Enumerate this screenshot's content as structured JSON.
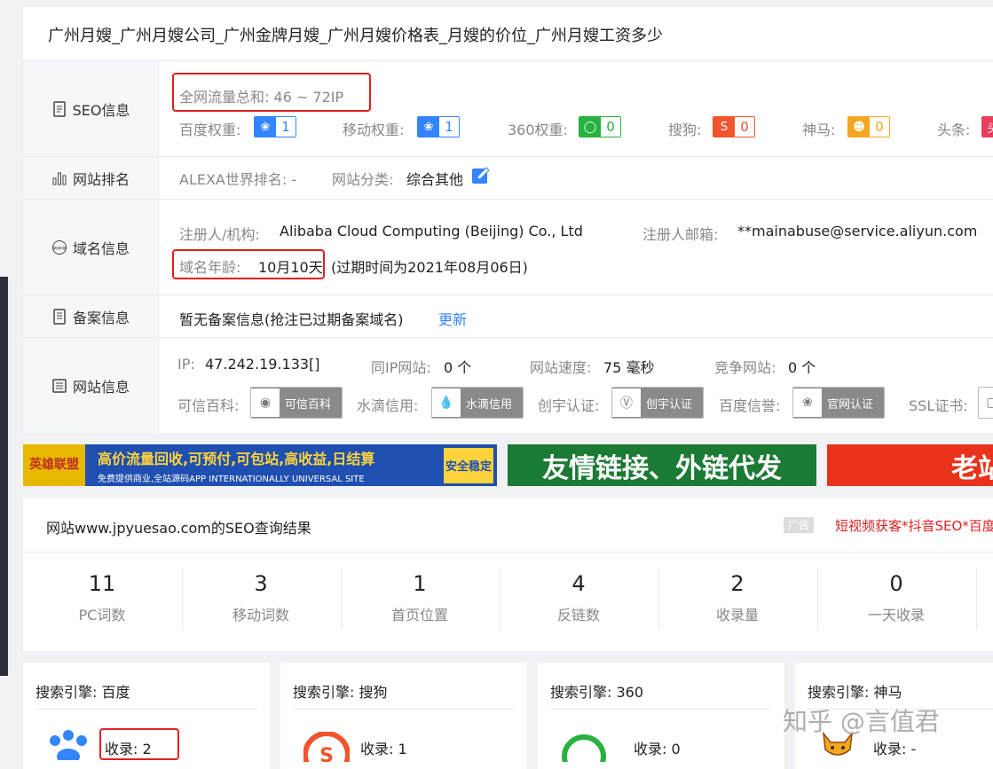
{
  "header": {
    "title": "广州月嫂_广州月嫂公司_广州金牌月嫂_广州月嫂价格表_月嫂的价位_广州月嫂工资多少"
  },
  "seo": {
    "label": "SEO信息",
    "traffic": "全网流量总和: 46 ~ 72IP",
    "weights": [
      {
        "name": "百度权重:",
        "value": "1",
        "icon": "paw-icon",
        "color": "#3385ff"
      },
      {
        "name": "移动权重:",
        "value": "1",
        "icon": "paw-icon",
        "color": "#3385ff"
      },
      {
        "name": "360权重:",
        "value": "0",
        "icon": "360-icon",
        "color": "#27b23f"
      },
      {
        "name": "搜狗:",
        "value": "0",
        "icon": "sogou-icon",
        "color": "#f2552c"
      },
      {
        "name": "神马:",
        "value": "0",
        "icon": "shenma-icon",
        "color": "#f5a623"
      },
      {
        "name": "头条:",
        "value": "",
        "icon": "toutiao-icon",
        "color": "#e83e5a"
      }
    ]
  },
  "rank": {
    "label": "网站排名",
    "alexa": "ALEXA世界排名: -",
    "category_label": "网站分类:",
    "category_value": "综合其他"
  },
  "domain": {
    "label": "域名信息",
    "registrant_label": "注册人/机构:",
    "registrant_value": "Alibaba Cloud Computing (Beijing) Co., Ltd",
    "email_label": "注册人邮箱:",
    "email_value": "**mainabuse@service.aliyun.com",
    "age_label": "域名年龄:",
    "age_value": "10月10天",
    "expiry": "(过期时间为2021年08月06日)"
  },
  "icp": {
    "label": "备案信息",
    "text": "暂无备案信息(抢注已过期备案域名)",
    "update": "更新"
  },
  "site": {
    "label": "网站信息",
    "ip_label": "IP:",
    "ip_value": "47.242.19.133[]",
    "same_ip_label": "同IP网站:",
    "same_ip_value": "0 个",
    "speed_label": "网站速度:",
    "speed_value": "75 毫秒",
    "compete_label": "竞争网站:",
    "compete_value": "0 个",
    "certs": [
      {
        "name": "可信百科:",
        "badge": "可信百科"
      },
      {
        "name": "水滴信用:",
        "badge": "水滴信用"
      },
      {
        "name": "创宇认证:",
        "badge": "创宇认证"
      },
      {
        "name": "百度信誉:",
        "badge": "官网认证"
      },
      {
        "name": "SSL证书:",
        "badge": ""
      }
    ]
  },
  "banners": [
    {
      "line1": "高价流量回收,可预付,可包站,高收益,日结算",
      "line2": "免费提供商业,全站源码APP  INTERNATIONALLY UNIVERSAL SITE",
      "logo": "英雄联盟",
      "tag": "安全稳定"
    },
    {
      "text": "友情链接、外链代发"
    },
    {
      "text": "老站"
    }
  ],
  "result": {
    "title": "网站www.jpyuesao.com的SEO查询结果",
    "ad_tag": "广告",
    "ad_text": "短视频获客*抖音SEO*百度",
    "stats": [
      {
        "value": "11",
        "label": "PC词数"
      },
      {
        "value": "3",
        "label": "移动词数"
      },
      {
        "value": "1",
        "label": "首页位置"
      },
      {
        "value": "4",
        "label": "反链数"
      },
      {
        "value": "2",
        "label": "收录量"
      },
      {
        "value": "0",
        "label": "一天收录"
      }
    ]
  },
  "engines": [
    {
      "label": "搜索引擎:",
      "name": "百度",
      "index_label": "收录:",
      "index_value": "2"
    },
    {
      "label": "搜索引擎:",
      "name": "搜狗",
      "index_label": "收录:",
      "index_value": "1"
    },
    {
      "label": "搜索引擎:",
      "name": "360",
      "index_label": "收录:",
      "index_value": "0"
    },
    {
      "label": "搜索引擎:",
      "name": "神马",
      "index_label": "收录:",
      "index_value": "-"
    }
  ],
  "watermark": "知乎 @言值君"
}
